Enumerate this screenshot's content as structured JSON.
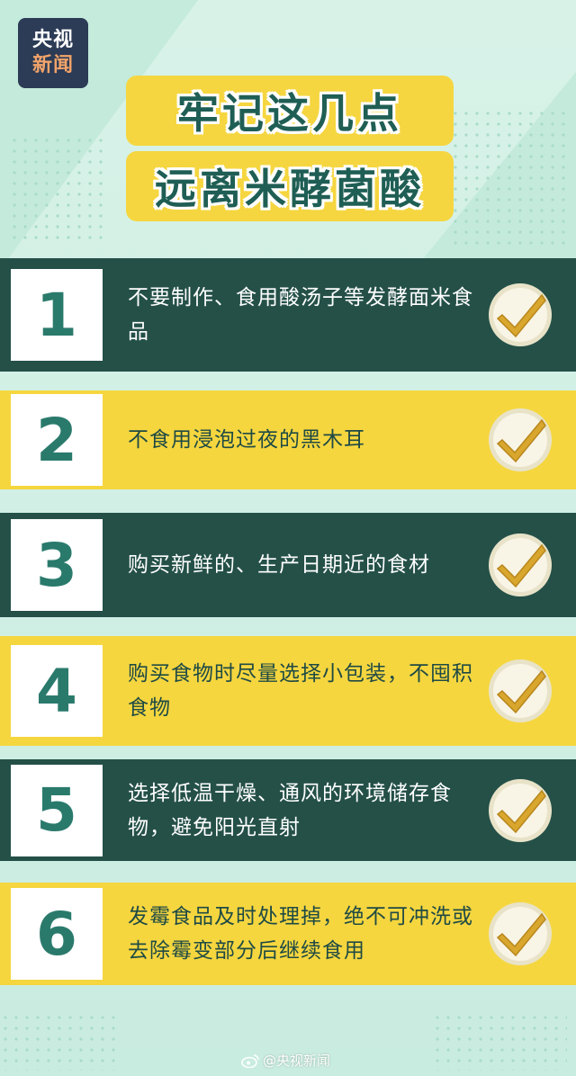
{
  "logo": {
    "line1": "央视",
    "line2": "新闻"
  },
  "title": {
    "line1": "牢记这几点",
    "line2": "远离米酵菌酸"
  },
  "items": [
    {
      "num": "1",
      "text": "不要制作、食用酸汤子等发酵面米食品",
      "theme": "dark"
    },
    {
      "num": "2",
      "text": "不食用浸泡过夜的黑木耳",
      "theme": "yellow"
    },
    {
      "num": "3",
      "text": "购买新鲜的、生产日期近的食材",
      "theme": "dark"
    },
    {
      "num": "4",
      "text": "购买食物时尽量选择小包装，不囤积食物",
      "theme": "yellow"
    },
    {
      "num": "5",
      "text": "选择低温干燥、通风的环境储存食物，避免阳光直射",
      "theme": "dark"
    },
    {
      "num": "6",
      "text": "发霉食品及时处理掉，绝不可冲洗或去除霉变部分后继续食用",
      "theme": "yellow"
    }
  ],
  "watermark": {
    "text": "@央视新闻",
    "icon": "weibo-icon"
  },
  "colors": {
    "dark_green": "#245048",
    "yellow": "#f5d63f",
    "number_green": "#2a7a6c",
    "background": "#cfeee2"
  }
}
